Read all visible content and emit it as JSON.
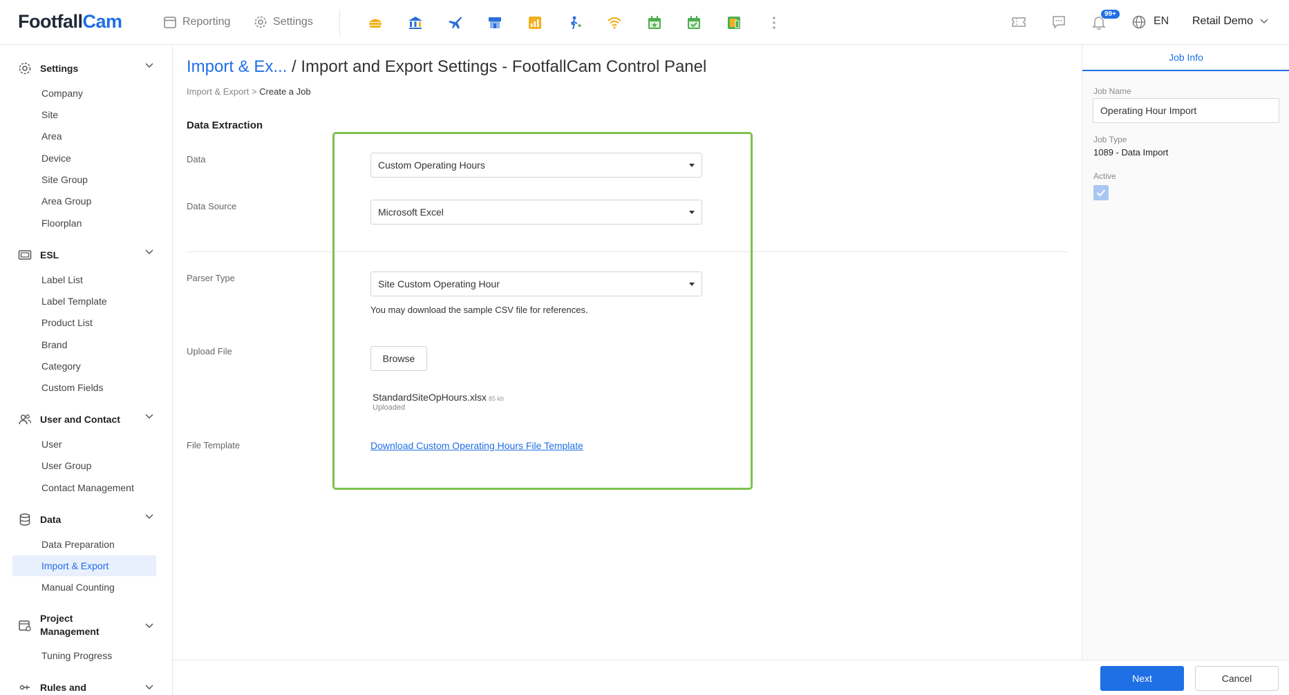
{
  "brand": {
    "part1": "Footfall",
    "part2": "Cam"
  },
  "topnav": {
    "reporting": "Reporting",
    "settings": "Settings"
  },
  "account": {
    "notifications_badge": "99+",
    "language": "EN",
    "name": "Retail Demo"
  },
  "colors": {
    "accent": "#1f6fe5",
    "highlight": "#7cc24d"
  },
  "sidebar": {
    "sections": [
      {
        "label": "Settings",
        "icon": "gear-icon",
        "items": [
          "Company",
          "Site",
          "Area",
          "Device",
          "Site Group",
          "Area Group",
          "Floorplan"
        ]
      },
      {
        "label": "ESL",
        "icon": "esl-icon",
        "items": [
          "Label List",
          "Label Template",
          "Product List",
          "Brand",
          "Category",
          "Custom Fields"
        ]
      },
      {
        "label": "User and Contact",
        "icon": "users-icon",
        "items": [
          "User",
          "User Group",
          "Contact Management"
        ]
      },
      {
        "label": "Data",
        "icon": "database-icon",
        "items": [
          "Data Preparation",
          "Import & Export",
          "Manual Counting"
        ]
      },
      {
        "label_line1": "Project",
        "label_line2": "Management",
        "icon": "project-icon",
        "items": [
          "Tuning Progress"
        ]
      },
      {
        "label": "Rules and",
        "icon": "rules-icon"
      }
    ],
    "active_item": "Import & Export"
  },
  "page": {
    "title_link": "Import & Ex...",
    "title_separator": "/",
    "title_rest": "Import and Export Settings - FootfallCam Control Panel",
    "breadcrumb": {
      "parent": "Import & Export",
      "separator": ">",
      "current": "Create a Job"
    },
    "section_heading": "Data Extraction"
  },
  "form": {
    "data_label": "Data",
    "data_value": "Custom Operating Hours",
    "source_label": "Data Source",
    "source_value": "Microsoft Excel",
    "parser_label": "Parser Type",
    "parser_value": "Site Custom Operating Hour",
    "parser_hint": "You may download the sample CSV file for references.",
    "upload_label": "Upload File",
    "browse_label": "Browse",
    "file_name": "StandardSiteOpHours.xlsx",
    "file_size": "85 kb",
    "file_status": "Uploaded",
    "template_label": "File Template",
    "template_link": "Download Custom Operating Hours File Template"
  },
  "job_info": {
    "tab": "Job Info",
    "name_label": "Job Name",
    "name_value": "Operating Hour Import",
    "type_label": "Job Type",
    "type_value": "1089 - Data Import",
    "active_label": "Active",
    "active_checked": true
  },
  "footer": {
    "next": "Next",
    "cancel": "Cancel"
  }
}
